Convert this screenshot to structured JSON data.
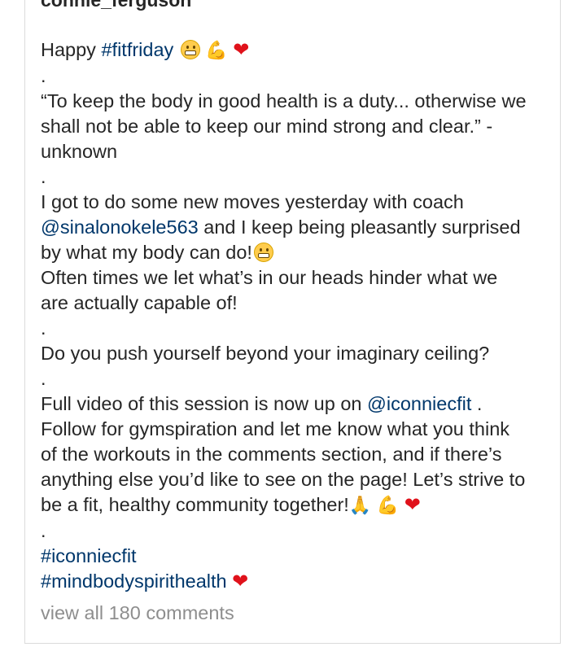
{
  "post": {
    "username": "connie_ferguson",
    "caption": {
      "l1_text": "Happy ",
      "l1_hashtag": "#fitfriday",
      "dot": ".",
      "quote_l1": "“To keep the body in good health is a duty... otherwise we",
      "quote_l2": "shall not be able to keep our mind strong and clear.” -",
      "quote_l3": "unknown",
      "p2_l1": "I got to do some new moves yesterday with coach",
      "p2_l2_mention": "@sinalonokele563",
      "p2_l2_text": " and I keep being pleasantly surprised",
      "p2_l3": "by what my body can do!",
      "p2_l4": "Often times we let what’s in our heads hinder what we",
      "p2_l5": "are actually capable of!",
      "p3_l1": "Do you push yourself beyond your imaginary ceiling?",
      "p4_l1_text": "Full video of this session is now up on ",
      "p4_l1_mention": "@iconniecfit",
      "p4_l1_end": " .",
      "p4_l2": "Follow for gymspiration and let me know what you think",
      "p4_l3": "of the workouts in the comments section, and if there’s",
      "p4_l4": "anything else you’d like to see on the page! Let’s strive to",
      "p4_l5": "be a fit, healthy community together!",
      "hashtag1": "#iconniecfit",
      "hashtag2": "#mindbodyspirithealth"
    },
    "emoji": {
      "heart": "❤",
      "muscle": "💪",
      "pray": "🙏"
    },
    "view_comments": "view all 180 comments"
  }
}
